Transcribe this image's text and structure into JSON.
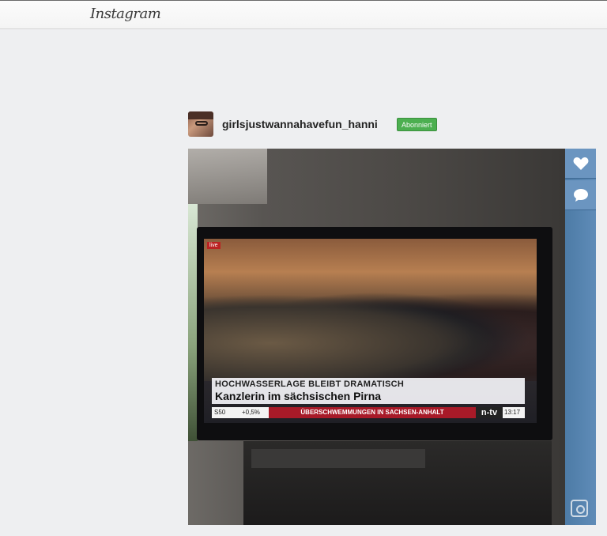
{
  "header": {
    "logo": "Instagram"
  },
  "post": {
    "username": "girlsjustwannahavefun_hanni",
    "follow_status": "Abonniert"
  },
  "tv": {
    "live_tag": "live",
    "headline_top": "HOCHWASSERLAGE BLEIBT DRAMATISCH",
    "headline_main": "Kanzlerin im sächsischen Pirna",
    "ticker_stock": "S50",
    "ticker_pct": "+0,5%",
    "ticker_banner": "ÜBERSCHWEMMUNGEN IN SACHSEN-ANHALT",
    "channel": "n-tv",
    "clock": "13:17"
  },
  "actions": {
    "like_icon": "heart-icon",
    "comment_icon": "comment-icon",
    "camera_icon": "instagram-camera-icon"
  },
  "colors": {
    "accent": "#4caf50",
    "sidebar": "#5f8cb8"
  }
}
